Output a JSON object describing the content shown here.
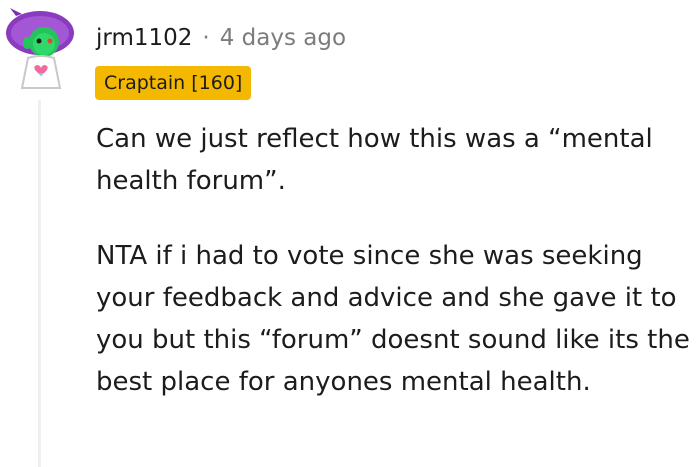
{
  "comment": {
    "username": "jrm1102",
    "separator": "·",
    "timestamp": "4 days ago",
    "flair": "Craptain [160]",
    "avatar_icon": "snoo-avatar-icon",
    "paragraphs": [
      "Can we just reflect how this was a “mental health forum”.",
      "NTA if i had to vote since she was seeking your feedback and advice and she gave it to you but this “forum” doesnt sound like its the best place for anyones mental health."
    ]
  },
  "colors": {
    "flair_background": "#f5b800",
    "avatar_background": "#8a3bbf",
    "avatar_face": "#23c45a",
    "muted_text": "#7c7c7c"
  }
}
